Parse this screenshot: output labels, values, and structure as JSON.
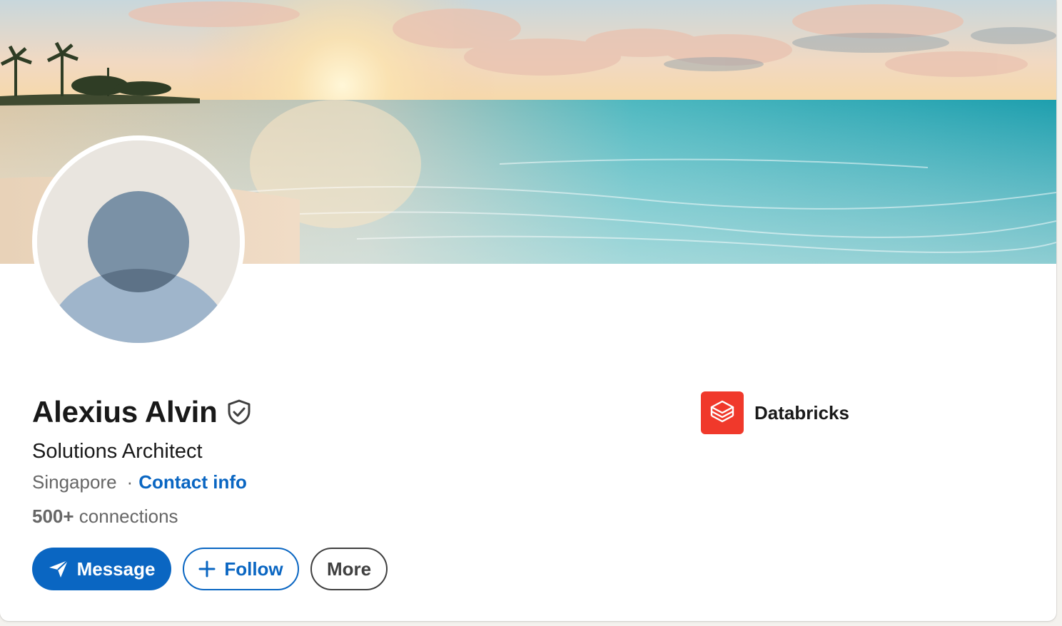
{
  "profile": {
    "name": "Alexius Alvin",
    "headline": "Solutions Architect",
    "location": "Singapore",
    "separator": "·",
    "contact_label": "Contact info",
    "connections_count": "500+",
    "connections_label": " connections"
  },
  "company": {
    "name": "Databricks",
    "logo_color": "#f0392b",
    "icon": "databricks-layers-icon"
  },
  "actions": {
    "message_label": "Message",
    "follow_label": "Follow",
    "more_label": "More"
  },
  "icons": {
    "verified": "verified-shield-icon",
    "message": "paper-plane-icon",
    "follow": "plus-icon"
  },
  "colors": {
    "accent": "#0a66c2",
    "text_primary": "#191919",
    "text_secondary": "#666666",
    "avatar_bg": "#e9e5df",
    "avatar_figure": "#9fb5cb"
  }
}
